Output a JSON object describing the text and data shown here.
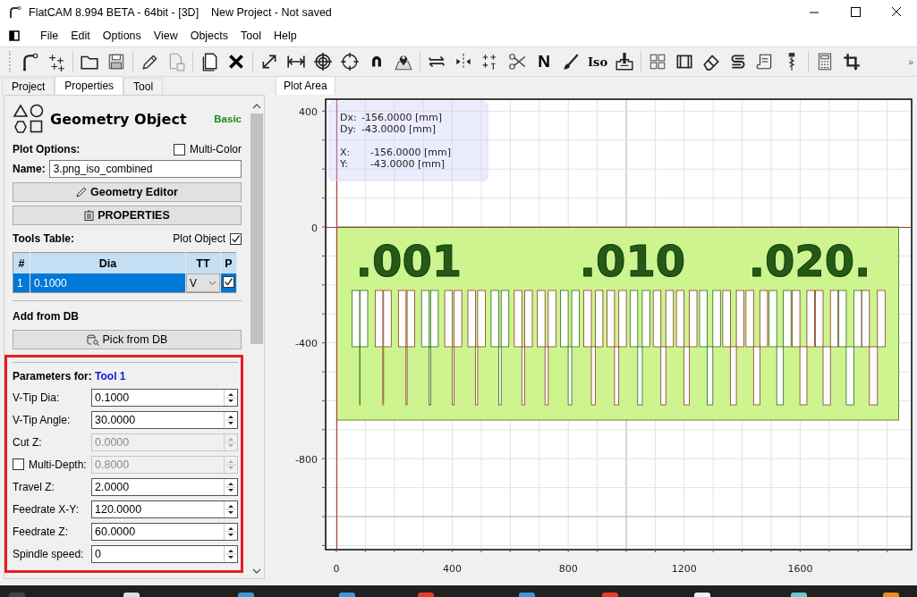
{
  "window": {
    "title": "FlatCAM 8.994 BETA - 64bit - [3D]    New Project - Not saved"
  },
  "menu": [
    "File",
    "Edit",
    "Options",
    "View",
    "Objects",
    "Tool",
    "Help"
  ],
  "toolbar": {
    "glyphs": [
      "N",
      "Iso"
    ],
    "overflow": "»"
  },
  "left_tabs": [
    {
      "label": "Project",
      "selected": false
    },
    {
      "label": "Properties",
      "selected": true
    },
    {
      "label": "Tool",
      "selected": false
    }
  ],
  "properties": {
    "title": "Geometry Object",
    "mode": "Basic",
    "plot_options_label": "Plot Options:",
    "multi_color": {
      "label": "Multi-Color",
      "checked": false
    },
    "name_label": "Name:",
    "name_value": "3.png_iso_combined",
    "buttons": [
      {
        "kind": "editor",
        "label": "Geometry Editor"
      },
      {
        "kind": "properties",
        "label": "PROPERTIES"
      }
    ],
    "tools_table_label": "Tools Table:",
    "plot_object": {
      "label": "Plot Object",
      "checked": true
    },
    "tools_table": {
      "columns": [
        "#",
        "Dia",
        "TT",
        "P"
      ],
      "rows": [
        {
          "number": "1",
          "dia": "0.1000",
          "tt": "V",
          "plot": true,
          "selected": true
        }
      ]
    },
    "add_from_db_label": "Add from DB",
    "pick_button": "Pick from DB",
    "parameters_label": "Parameters for:",
    "parameters_tool": "Tool 1",
    "parameters": [
      {
        "kind": "spin",
        "label": "V-Tip Dia:",
        "value": "0.1000",
        "disabled": false
      },
      {
        "kind": "spin",
        "label": "V-Tip Angle:",
        "value": "30.0000",
        "disabled": false
      },
      {
        "kind": "spin",
        "label": "Cut Z:",
        "value": "0.0000",
        "disabled": true
      },
      {
        "kind": "check_spin",
        "label": "Multi-Depth:",
        "checked": false,
        "value": "0.8000",
        "disabled": true
      },
      {
        "kind": "spin",
        "label": "Travel Z:",
        "value": "2.0000",
        "disabled": false
      },
      {
        "kind": "spin",
        "label": "Feedrate X-Y:",
        "value": "120.0000",
        "disabled": false
      },
      {
        "kind": "spin",
        "label": "Feedrate Z:",
        "value": "60.0000",
        "disabled": false
      },
      {
        "kind": "spin",
        "label": "Spindle speed:",
        "value": "0",
        "disabled": false
      }
    ]
  },
  "plot_tabs": [
    {
      "label": "Plot Area",
      "selected": true
    }
  ],
  "plot": {
    "info": [
      [
        {
          "label": "Dx:",
          "value": "-156.0000 [mm]"
        },
        {
          "label": "Dy:",
          "value": "-43.0000 [mm]"
        }
      ],
      [
        {
          "label": "X:",
          "value": "-156.0000 [mm]"
        },
        {
          "label": "Y:",
          "value": "-43.0000 [mm]"
        }
      ]
    ],
    "y_ticks": [
      "400",
      "0",
      "-400",
      "-800"
    ],
    "x_ticks": [
      "0",
      "400",
      "800",
      "1200",
      "1600"
    ],
    "labels": [
      ".001",
      ".010",
      ".020."
    ]
  }
}
